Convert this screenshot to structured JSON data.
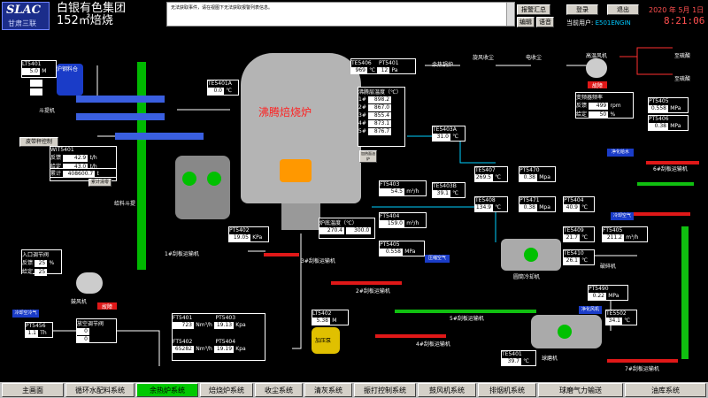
{
  "header": {
    "logo": "SLAC",
    "logo_sub": "甘肃三联",
    "company": "白银有色集团",
    "subtitle": "152㎡焙烧",
    "message": "无法获取事件，请在视图下无法获取报警列表信息。",
    "btn_alarm": "报警汇总",
    "btn_login": "登录",
    "btn_exit": "退出",
    "btn_edit": "编辑",
    "btn_voice": "语音",
    "user_label": "当前用户:",
    "user_name": "E501ENGIN",
    "date": "2020 年 5月 1日",
    "time": "8:21:06"
  },
  "furnace": {
    "title": "沸腾焙烧炉",
    "temp_title": "沸腾层温度（℃）",
    "temps": [
      {
        "label": "1#",
        "value": "898.2"
      },
      {
        "label": "2#",
        "value": "867.0"
      },
      {
        "label": "3#",
        "value": "855.4"
      },
      {
        "label": "4#",
        "value": "873.1"
      },
      {
        "label": "5#",
        "value": "876.7"
      }
    ],
    "bottom_temp_title": "炉底温度（℃）",
    "bottom_temps": [
      "270.4",
      "300.0"
    ],
    "seal_label": "加热面油炉"
  },
  "instruments": [
    {
      "tag": "LT5401",
      "value": "5.0",
      "unit": "M"
    },
    {
      "tag": "TE5401A",
      "value": "0.0",
      "unit": "℃"
    },
    {
      "tag": "TE5406",
      "value": "969",
      "unit": "℃"
    },
    {
      "tag": "PT5401",
      "value": "12",
      "unit": "Pa"
    },
    {
      "tag": "PT5402",
      "value": "19.05",
      "unit": "KPa"
    },
    {
      "tag": "FT5403",
      "value": "54.5",
      "unit": "m³/h"
    },
    {
      "tag": "TE5403A",
      "value": "31.0",
      "unit": "℃"
    },
    {
      "tag": "TE5403B",
      "value": "39.1",
      "unit": "℃"
    },
    {
      "tag": "FT5404",
      "value": "159.0",
      "unit": "m³/h"
    },
    {
      "tag": "PT5405",
      "value": "0.558",
      "unit": "MPa"
    },
    {
      "tag": "TE5407",
      "value": "269.5",
      "unit": "℃"
    },
    {
      "tag": "PT5470",
      "value": "0.38",
      "unit": "Mpa"
    },
    {
      "tag": "TE5408",
      "value": "134.9",
      "unit": "℃"
    },
    {
      "tag": "PT5471",
      "value": "0.38",
      "unit": "Mpa"
    },
    {
      "tag": "PT5404",
      "value": "40.9",
      "unit": "℃"
    },
    {
      "tag": "TE5409",
      "value": "21.7",
      "unit": "℃"
    },
    {
      "tag": "FT5405",
      "value": "211.2",
      "unit": "m³/h"
    },
    {
      "tag": "TE5410",
      "value": "26.1",
      "unit": "℃"
    },
    {
      "tag": "PT5405",
      "value": "0.558",
      "unit": "MPa"
    },
    {
      "tag": "PT5406",
      "value": "0.38",
      "unit": "MPa"
    },
    {
      "tag": "PT5490",
      "value": "0.22",
      "unit": "MPa"
    },
    {
      "tag": "TE5502",
      "value": "34.1",
      "unit": "℃"
    },
    {
      "tag": "TE5401",
      "value": "39.7",
      "unit": "℃"
    },
    {
      "tag": "LT5402",
      "value": "5.38",
      "unit": "M"
    },
    {
      "tag": "PT5456",
      "value": "1.1",
      "unit": "Th"
    }
  ],
  "feed": {
    "tag": "WIT5401",
    "actual_label": "反馈",
    "actual": "42.9",
    "actual_unit": "t/h",
    "set_label": "给定",
    "set": "43.0",
    "set_unit": "t/h",
    "total_label": "累计",
    "total": "408600.7",
    "total_unit": "t",
    "clear_label": "累计清零"
  },
  "fan": {
    "title": "高温风机",
    "status": "故障",
    "freq_title": "变频器频率",
    "fb_label": "反馈",
    "fb": "499",
    "fb_unit": "rpm",
    "set_label": "给定",
    "set": "50",
    "set_unit": "%"
  },
  "inlet": {
    "title": "入口调节阀",
    "fb_label": "反馈",
    "fb": "25",
    "set_label": "给定",
    "set": "25",
    "unit": "%",
    "fan_label": "鼓风机",
    "fan_status": "故障",
    "return_title": "放空调节阀",
    "rfb": "0",
    "rset": "0",
    "cold_btn": "冷却空冷气"
  },
  "flow": [
    {
      "tag": "FT5401",
      "value": "723",
      "unit": "Nm³/h"
    },
    {
      "tag": "PT5403",
      "value": "19.13",
      "unit": "Kpa"
    },
    {
      "tag": "FT5402",
      "value": "65282",
      "unit": "Nm³/h"
    },
    {
      "tag": "PT5404",
      "value": "19.19",
      "unit": "Kpa"
    }
  ],
  "labels": {
    "silo": "沪钢料仓",
    "feeder": "皮带秤控制",
    "elevator": "斗提机",
    "bin": "给料斗提",
    "sep": "圆筒冷却机",
    "ball": "球磨机",
    "pump": "加压泵",
    "acid": "至硫酸",
    "acid2": "至硫酸",
    "conv1": "1#刮板运输机",
    "conv2": "2#刮板运输机",
    "conv3": "3#刮板运输机",
    "conv4": "4#刮板运输机",
    "conv5": "5#刮板运输机",
    "conv6": "6#刮板运输机",
    "conv7": "7#刮板运输机",
    "cyclone": "旋风收尘",
    "waste": "余热锅炉",
    "electro": "电收尘",
    "air_btn": "压缩空气",
    "water_btn": "净化给水",
    "water2": "净化风机",
    "cold2": "冷却空气",
    "hammer": "破碎机"
  },
  "nav": [
    "主画面",
    "循环水配料系统",
    "余热炉系统",
    "焙烧炉系统",
    "收尘系统",
    "清灰系统",
    "振打控制系统",
    "鼓风机系统",
    "排烟机系统",
    "球磨气力输送",
    "油库系统"
  ],
  "nav_active": 2
}
